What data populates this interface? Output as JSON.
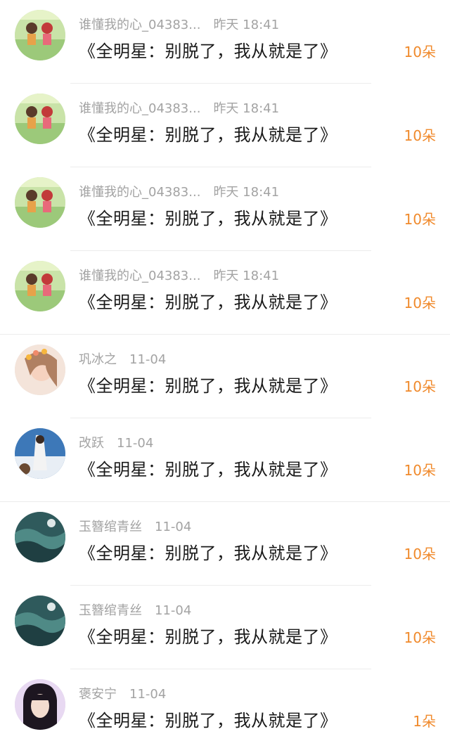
{
  "items": [
    {
      "user": "谁懂我的心_04383...",
      "time": "昨天 18:41",
      "title": "《全明星：别脱了，我从就是了》",
      "flowers": "10朵",
      "avatar": "anime-kids"
    },
    {
      "user": "谁懂我的心_04383...",
      "time": "昨天 18:41",
      "title": "《全明星：别脱了，我从就是了》",
      "flowers": "10朵",
      "avatar": "anime-kids"
    },
    {
      "user": "谁懂我的心_04383...",
      "time": "昨天 18:41",
      "title": "《全明星：别脱了，我从就是了》",
      "flowers": "10朵",
      "avatar": "anime-kids"
    },
    {
      "user": "谁懂我的心_04383...",
      "time": "昨天 18:41",
      "title": "《全明星：别脱了，我从就是了》",
      "flowers": "10朵",
      "avatar": "anime-kids"
    },
    {
      "user": "巩冰之",
      "time": "11-04",
      "title": "《全明星：别脱了，我从就是了》",
      "flowers": "10朵",
      "avatar": "girl-flowers"
    },
    {
      "user": "改跃",
      "time": "11-04",
      "title": "《全明星：别脱了，我从就是了》",
      "flowers": "10朵",
      "avatar": "sky-figure"
    },
    {
      "user": "玉簪绾青丝",
      "time": "11-04",
      "title": "《全明星：别脱了，我从就是了》",
      "flowers": "10朵",
      "avatar": "sea-waves"
    },
    {
      "user": "玉簪绾青丝",
      "time": "11-04",
      "title": "《全明星：别脱了，我从就是了》",
      "flowers": "10朵",
      "avatar": "sea-waves"
    },
    {
      "user": "褒安宁",
      "time": "11-04",
      "title": "《全明星：别脱了，我从就是了》",
      "flowers": "1朵",
      "avatar": "dark-hair-girl"
    }
  ]
}
